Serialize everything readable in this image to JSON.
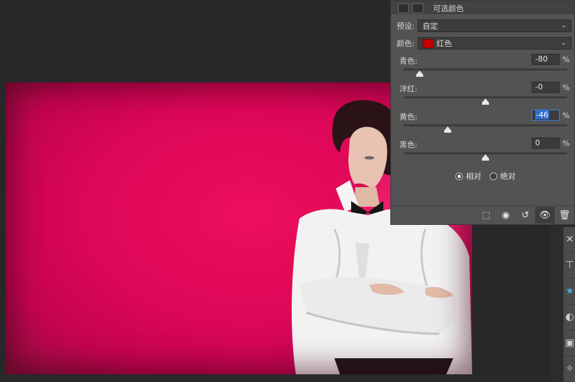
{
  "panel": {
    "title": "可选颜色",
    "preset_label": "预设:",
    "preset_value": "自定",
    "colors_label": "颜色:",
    "colors_value": "红色",
    "colors_swatch": "#c30000",
    "sliders": [
      {
        "label": "青色:",
        "value": "-80",
        "unit": "%",
        "fraction": 0.1
      },
      {
        "label": "洋红:",
        "value": "-0",
        "unit": "%",
        "fraction": 0.5
      },
      {
        "label": "黄色:",
        "value": "-46",
        "unit": "%",
        "fraction": 0.27,
        "active": true
      },
      {
        "label": "黑色:",
        "value": "0",
        "unit": "%",
        "fraction": 0.5
      }
    ],
    "method_relative": "相对",
    "method_absolute": "绝对",
    "method_selected": "相对"
  },
  "colors": {
    "canvas_bg": "#de0758",
    "panel_bg": "#535353",
    "app_bg": "#282828",
    "selection_blue": "#2f6bc8"
  },
  "icons": {
    "footer": [
      "clip-to-layer-icon",
      "view-previous-state-icon",
      "reset-icon",
      "visibility-eye-icon",
      "delete-trash-icon"
    ],
    "tools": [
      "tool-icon-1",
      "tool-icon-2",
      "tool-icon-3",
      "tool-icon-4",
      "tool-icon-5",
      "tool-icon-6"
    ]
  }
}
